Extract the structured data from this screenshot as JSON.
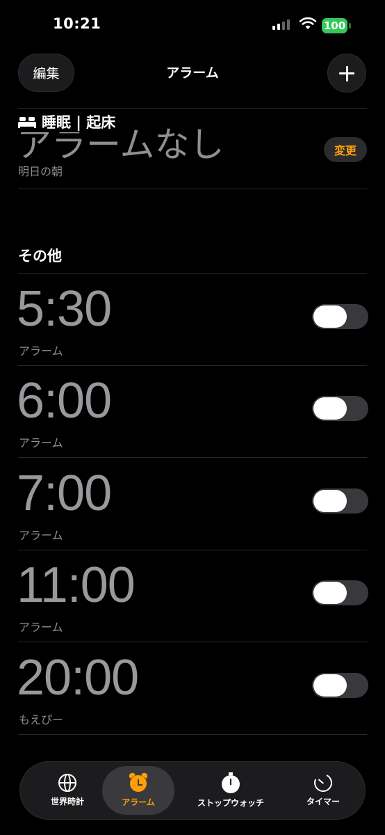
{
  "status_bar": {
    "time": "10:21",
    "battery": "100"
  },
  "nav": {
    "edit_label": "編集",
    "title": "アラーム"
  },
  "sleep": {
    "header": "睡眠 | 起床",
    "no_alarm": "アラームなし",
    "subtitle": "明日の朝",
    "change_label": "変更"
  },
  "other_header": "その他",
  "alarms": [
    {
      "time": "5:30",
      "label": "アラーム",
      "enabled": false
    },
    {
      "time": "6:00",
      "label": "アラーム",
      "enabled": false
    },
    {
      "time": "7:00",
      "label": "アラーム",
      "enabled": false
    },
    {
      "time": "11:00",
      "label": "アラーム",
      "enabled": false
    },
    {
      "time": "20:00",
      "label": "もえぴー",
      "enabled": false
    }
  ],
  "tabs": [
    {
      "label": "世界時計",
      "icon": "globe-icon"
    },
    {
      "label": "アラーム",
      "icon": "alarm-clock-icon",
      "active": true
    },
    {
      "label": "ストップウォッチ",
      "icon": "stopwatch-icon"
    },
    {
      "label": "タイマー",
      "icon": "timer-icon"
    }
  ],
  "colors": {
    "accent": "#ff9f0a",
    "battery": "#34c759",
    "background": "#000000"
  }
}
